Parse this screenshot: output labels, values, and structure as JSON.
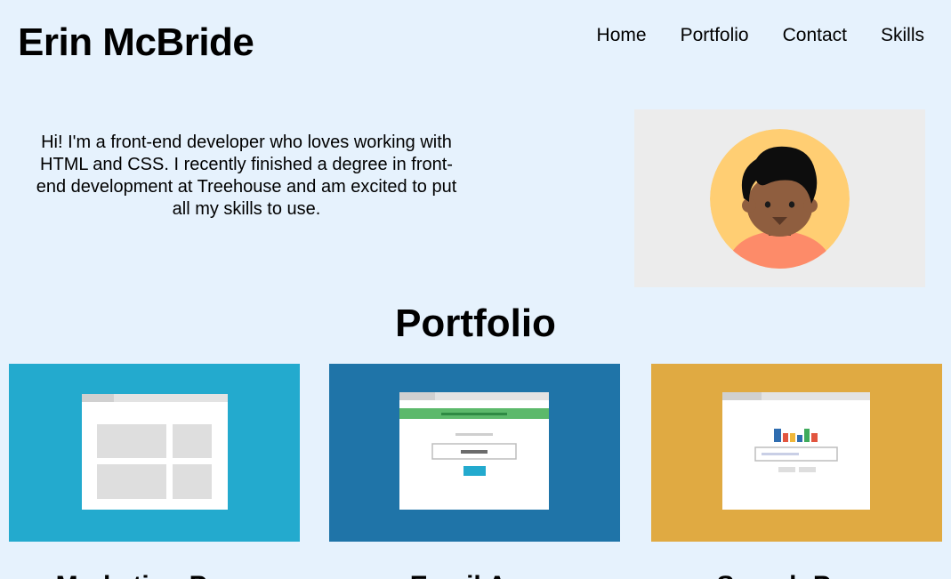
{
  "header": {
    "site_title": "Erin McBride",
    "nav": [
      {
        "label": "Home"
      },
      {
        "label": "Portfolio"
      },
      {
        "label": "Contact"
      },
      {
        "label": "Skills"
      }
    ]
  },
  "intro": {
    "text": "Hi! I'm a front-end developer who loves working with HTML and CSS. I recently finished a degree in front-end development at Treehouse and am excited to put all my skills to use."
  },
  "portfolio": {
    "title": "Portfolio",
    "projects": [
      {
        "caption": "Marketing Page",
        "bg_color": "#23aace",
        "icon": "layout-grid-mockup"
      },
      {
        "caption": "Email App",
        "bg_color": "#1f74a8",
        "icon": "signup-form-mockup"
      },
      {
        "caption": "Search Page",
        "bg_color": "#e0aa42",
        "icon": "search-results-mockup"
      }
    ]
  },
  "colors": {
    "background": "#e6f2fd",
    "avatar_circle": "#ffce73",
    "avatar_shirt": "#fd8b69",
    "avatar_skin": "#8f5e3f"
  }
}
